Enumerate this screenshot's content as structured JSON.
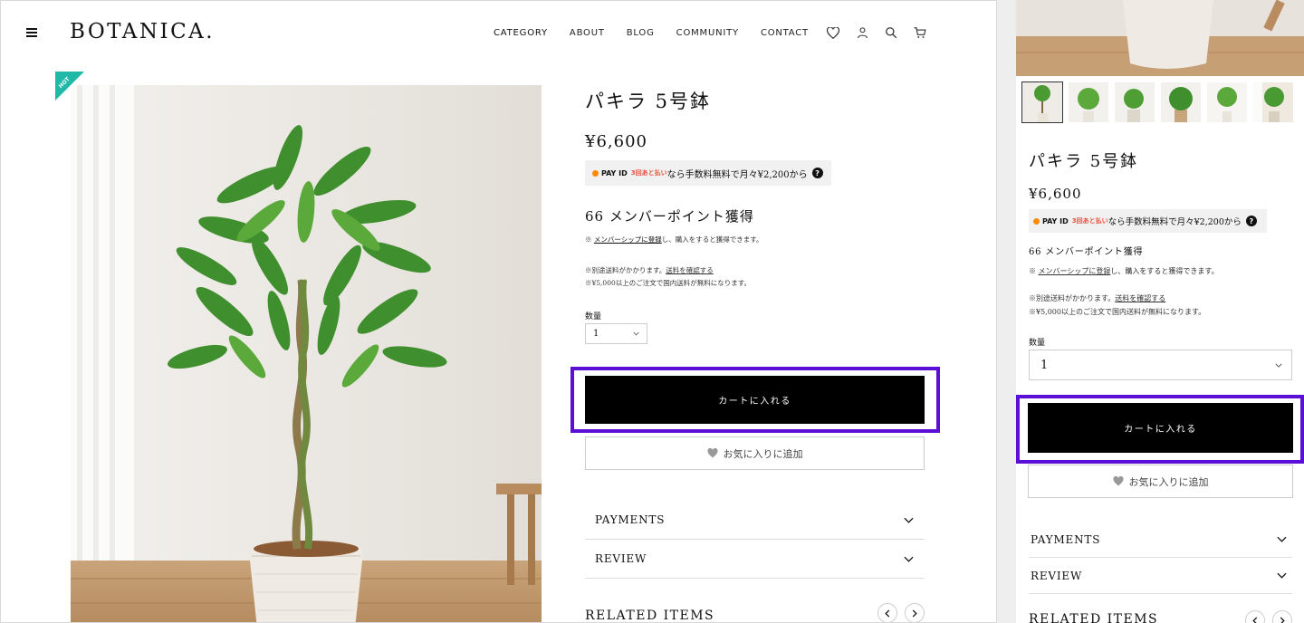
{
  "header": {
    "logo": "BOTANICA.",
    "nav": [
      "CATEGORY",
      "ABOUT",
      "BLOG",
      "COMMUNITY",
      "CONTACT"
    ],
    "icons": [
      "heart-icon",
      "user-icon",
      "search-icon",
      "cart-icon"
    ]
  },
  "badge": "HOT",
  "product": {
    "title": "パキラ 5号鉢",
    "price": "¥6,600",
    "payid": {
      "brand": "PAY ID",
      "promo": "3回あと払い",
      "text": "なら手数料無料で月々¥2,200から",
      "help": "?"
    },
    "points": "66 メンバーポイント獲得",
    "note_prefix": "※",
    "note_link": "メンバーシップに登録",
    "note_suffix": "し、購入をすると獲得できます。",
    "ship_line1": "※別途送料がかかります。",
    "ship_link": "送料を確認する",
    "ship_line2": "※¥5,000以上のご注文で国内送料が無料になります。",
    "qty_label": "数量",
    "qty_value": "1",
    "cart_button": "カートに入れる",
    "fav_button": "お気に入りに追加",
    "accordions": [
      "PAYMENTS",
      "REVIEW"
    ],
    "related": "RELATED ITEMS"
  },
  "colors": {
    "highlight": "#5b0fd6",
    "badge": "#22b8a7",
    "cart_bg": "#000000"
  }
}
